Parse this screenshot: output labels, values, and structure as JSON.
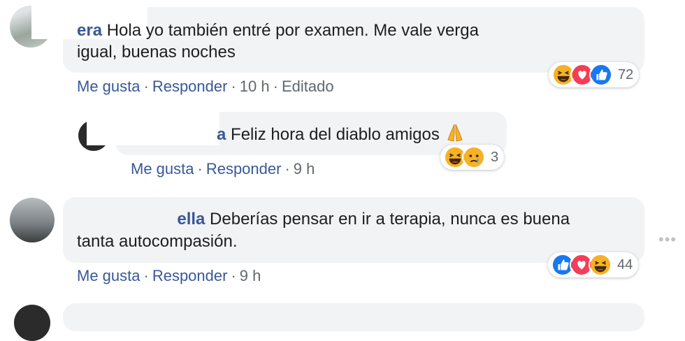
{
  "comments": [
    {
      "author": "era",
      "text_line1": "Hola yo también entré por examen. Me vale verga",
      "text_line2": "igual, buenas noches",
      "like": "Me gusta",
      "reply": "Responder",
      "time": "10 h",
      "edited": "Editado",
      "reactions": [
        "laugh",
        "love",
        "like"
      ],
      "reaction_count": "72"
    },
    {
      "author": "a",
      "text_line1": "Feliz hora del diablo amigos",
      "emoji": "pray",
      "like": "Me gusta",
      "reply": "Responder",
      "time": "9 h",
      "reactions": [
        "laugh",
        "sad"
      ],
      "reaction_count": "3"
    },
    {
      "author": "ella",
      "text_line1": "Deberías pensar en ir a terapia, nunca es buena",
      "text_line2": "tanta autocompasión.",
      "like": "Me gusta",
      "reply": "Responder",
      "time": "9 h",
      "reactions": [
        "like",
        "love",
        "laugh"
      ],
      "reaction_count": "44"
    }
  ],
  "colors": {
    "link": "#385898",
    "bubble": "#f2f3f5",
    "like": "#1877f2",
    "love": "#f33e58",
    "haha": "#f7b125"
  },
  "more_options_glyph": "•••"
}
